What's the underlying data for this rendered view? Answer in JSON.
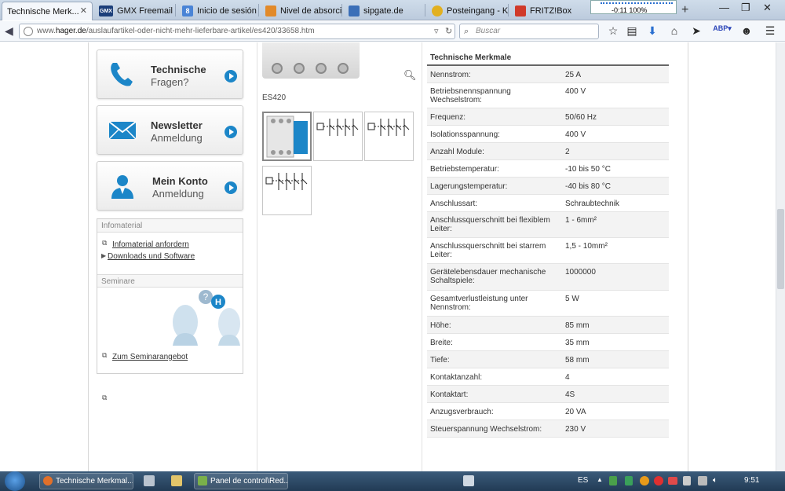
{
  "browser": {
    "tabs": [
      {
        "label": "Technische Merk...",
        "icon_text": "",
        "icon_color": "#1b66b0",
        "active": true
      },
      {
        "label": "GMX Freemail - ...",
        "icon_text": "GMX",
        "icon_color": "#1c3f7a",
        "active": false
      },
      {
        "label": "Inicio de sesión ...",
        "icon_text": "8",
        "icon_color": "#4a84d6",
        "active": false
      },
      {
        "label": "Nivel de absorci...",
        "icon_text": "",
        "icon_color": "#e28a2a",
        "active": false
      },
      {
        "label": "sipgate.de",
        "icon_text": "",
        "icon_color": "#3b6fb8",
        "active": false
      },
      {
        "label": "Posteingang - K...",
        "icon_text": "",
        "icon_color": "#e2b020",
        "active": false
      },
      {
        "label": "FRITZ!Box",
        "icon_text": "",
        "icon_color": "#d03a2a",
        "active": false
      }
    ],
    "media": {
      "time": "-0:11",
      "volume": "100%"
    },
    "url": {
      "prefix": "www.",
      "host": "hager.de",
      "path": "/auslaufartikel-oder-nicht-mehr-lieferbare-artikel/es420/33658.htm"
    },
    "search_placeholder": "Buscar"
  },
  "sidebar": {
    "service_buttons": [
      {
        "title": "Technische",
        "subtitle": "Fragen?",
        "icon": "phone-icon"
      },
      {
        "title": "Newsletter",
        "subtitle": "Anmeldung",
        "icon": "envelope-icon"
      },
      {
        "title": "Mein Konto",
        "subtitle": "Anmeldung",
        "icon": "user-icon"
      }
    ],
    "infomaterial": {
      "header": "Infomaterial",
      "links": [
        "Infomaterial anfordern",
        "Downloads und Software"
      ]
    },
    "seminare": {
      "header": "Seminare",
      "link": "Zum Seminarangebot"
    }
  },
  "product": {
    "code": "ES420"
  },
  "specs": {
    "title": "Technische Merkmale",
    "rows": [
      {
        "key": "Nennstrom:",
        "value": "25 A"
      },
      {
        "key": "Betriebsnennspannung Wechselstrom:",
        "value": "400 V"
      },
      {
        "key": "Frequenz:",
        "value": "50/60 Hz"
      },
      {
        "key": "Isolationsspannung:",
        "value": "400 V"
      },
      {
        "key": "Anzahl Module:",
        "value": "2"
      },
      {
        "key": "Betriebstemperatur:",
        "value": "-10 bis 50 °C"
      },
      {
        "key": "Lagerungstemperatur:",
        "value": "-40 bis 80 °C"
      },
      {
        "key": "Anschlussart:",
        "value": "Schraubtechnik"
      },
      {
        "key": "Anschlussquerschnitt bei flexiblem Leiter:",
        "value": "1 - 6mm²"
      },
      {
        "key": "Anschlussquerschnitt bei starrem Leiter:",
        "value": "1,5 - 10mm²"
      },
      {
        "key": "Gerätelebensdauer mechanische Schaltspiele:",
        "value": "1000000"
      },
      {
        "key": "Gesamtverlustleistung unter Nennstrom:",
        "value": "5 W"
      },
      {
        "key": "Höhe:",
        "value": "85 mm"
      },
      {
        "key": "Breite:",
        "value": "35 mm"
      },
      {
        "key": "Tiefe:",
        "value": "58 mm"
      },
      {
        "key": "Kontaktanzahl:",
        "value": "4"
      },
      {
        "key": "Kontaktart:",
        "value": "4S"
      },
      {
        "key": "Anzugsverbrauch:",
        "value": "20 VA"
      },
      {
        "key": "Steuerspannung Wechselstrom:",
        "value": "230 V"
      }
    ]
  },
  "taskbar": {
    "items": [
      {
        "label": "Technische Merkmal...",
        "icon_color": "#e2702a"
      },
      {
        "label": "Panel de control\\Red...",
        "icon_color": "#7ab04a"
      }
    ],
    "lang": "ES",
    "clock": "9:51"
  }
}
